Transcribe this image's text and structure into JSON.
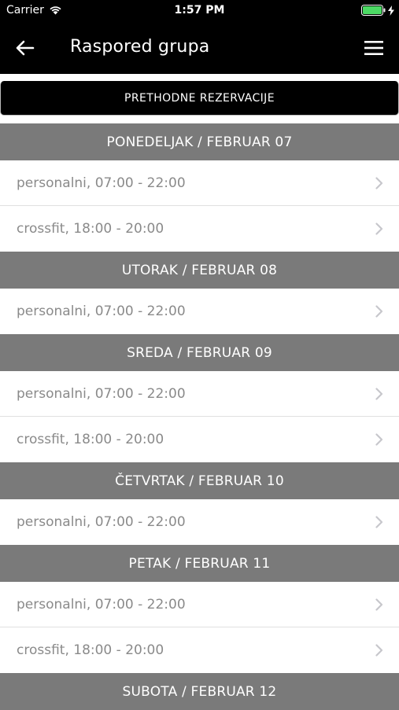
{
  "status_bar": {
    "carrier": "Carrier",
    "time": "1:57 PM"
  },
  "nav": {
    "title": "Raspored grupa"
  },
  "prev_button": {
    "label": "PRETHODNE REZERVACIJE"
  },
  "days": [
    {
      "header": "PONEDELJAK / FEBRUAR 07",
      "sessions": [
        "personalni, 07:00 - 22:00",
        "crossfit, 18:00 - 20:00"
      ]
    },
    {
      "header": "UTORAK / FEBRUAR 08",
      "sessions": [
        "personalni, 07:00 - 22:00"
      ]
    },
    {
      "header": "SREDA / FEBRUAR 09",
      "sessions": [
        "personalni, 07:00 - 22:00",
        "crossfit, 18:00 - 20:00"
      ]
    },
    {
      "header": "ČETVRTAK / FEBRUAR 10",
      "sessions": [
        "personalni, 07:00 - 22:00"
      ]
    },
    {
      "header": "PETAK / FEBRUAR 11",
      "sessions": [
        "personalni, 07:00 - 22:00",
        "crossfit, 18:00 - 20:00"
      ]
    },
    {
      "header": "SUBOTA / FEBRUAR 12",
      "sessions": []
    }
  ],
  "colors": {
    "header_bg": "#7a7a7a",
    "nav_bg": "#000000",
    "row_text": "#8a8a8a",
    "battery": "#4cd964"
  },
  "icons": {
    "back": "arrow-left-icon",
    "menu": "hamburger-menu-icon",
    "row": "chevron-right-icon",
    "wifi": "wifi-icon",
    "battery": "battery-icon",
    "charging": "charging-bolt-icon"
  }
}
